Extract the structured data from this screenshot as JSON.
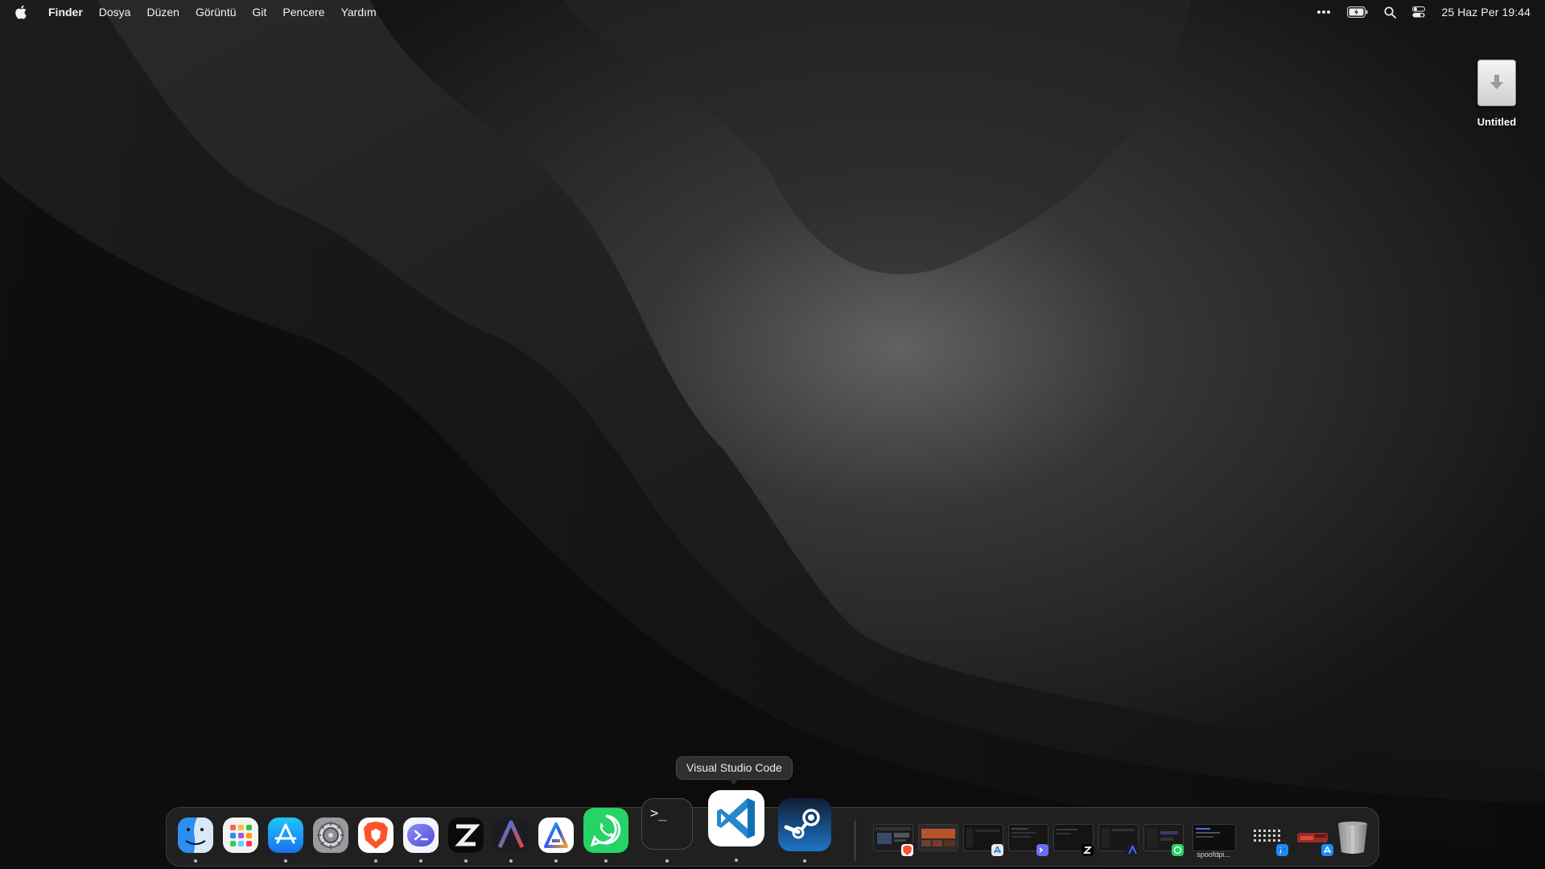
{
  "menubar": {
    "app_name": "Finder",
    "menus": [
      "Dosya",
      "Düzen",
      "Görüntü",
      "Git",
      "Pencere",
      "Yardım"
    ],
    "status_icons": [
      "more-icon",
      "battery-icon",
      "search-icon",
      "control-center-icon"
    ],
    "clock": "25 Haz Per  19:44"
  },
  "desktop": {
    "drive_label": "Untitled"
  },
  "tooltip": {
    "text": "Visual Studio Code"
  },
  "dock": {
    "apps": [
      {
        "name": "finder-icon",
        "color": "#1e8bf5"
      },
      {
        "name": "launchpad-icon",
        "color": "#f1f1f1"
      },
      {
        "name": "app-store-icon",
        "color": "#1d8cf8"
      },
      {
        "name": "system-settings-icon",
        "color": "#8e8e93"
      },
      {
        "name": "brave-icon",
        "color": "#fb542b"
      },
      {
        "name": "prompt-icon",
        "color": "#6b6ef0"
      },
      {
        "name": "zed-icon",
        "color": "#000000"
      },
      {
        "name": "arc-icon",
        "color": "#1a1a2e"
      },
      {
        "name": "altstore-icon",
        "color": "#ffffff"
      },
      {
        "name": "whatsapp-icon",
        "color": "#25d366"
      },
      {
        "name": "terminal-icon",
        "color": "#1e1e1e",
        "label": ">_"
      },
      {
        "name": "vscode-icon",
        "color": "#ffffff"
      },
      {
        "name": "steam-icon",
        "color": "#1b2838"
      }
    ],
    "minimized_windows": [
      {
        "name": "brave-window-icon",
        "badge": "#fb542b"
      },
      {
        "name": "browser-window-icon",
        "badge": ""
      },
      {
        "name": "app-store-window-icon",
        "badge": "#e0e0e0"
      },
      {
        "name": "prompt-window-icon",
        "badge": "#6b6ef0"
      },
      {
        "name": "zed-window-icon",
        "badge": "#000000"
      },
      {
        "name": "arc-window-icon",
        "badge": "#1a1a2e"
      },
      {
        "name": "whatsapp-window-icon",
        "badge": "#25d366"
      },
      {
        "name": "terminal-window-icon",
        "badge": "",
        "caption": "spoofdpi..."
      },
      {
        "name": "launchpad-window-icon",
        "badge": "#1e8bf5"
      },
      {
        "name": "app-store-window-icon-2",
        "badge": "#1d8cf8"
      }
    ],
    "trash": "trash-icon"
  }
}
